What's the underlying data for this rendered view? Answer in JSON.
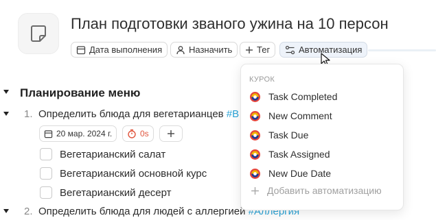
{
  "task": {
    "title": "План подготовки званого ужина на 10 персон",
    "icon": "note-icon"
  },
  "toolbar": {
    "due_date_label": "Дата выполнения",
    "assign_label": "Назначить",
    "tag_label": "Тег",
    "automation_label": "Автоматизация"
  },
  "section": {
    "title": "Планирование меню"
  },
  "items": [
    {
      "number": "1.",
      "text": "Определить блюда для вегетарианцев ",
      "hashtag": "#В",
      "date": "20 мар. 2024 г.",
      "timer": "0s",
      "subtasks": [
        "Вегетарианский салат",
        "Вегетарианский основной курс",
        "Вегетарианский десерт"
      ]
    },
    {
      "number": "2.",
      "text": "Определить блюда для людей с аллергией ",
      "hashtag": "#Аллергия"
    }
  ],
  "automation_menu": {
    "section_label": "КУРОК",
    "items": [
      "Task Completed",
      "New Comment",
      "Task Due",
      "Task Assigned",
      "New Due Date"
    ],
    "add_label": "Добавить автоматизацию"
  },
  "colors": {
    "hashtag": "#2aa3d6",
    "timer": "#e0553d",
    "active_pill": "#eef3fa"
  }
}
